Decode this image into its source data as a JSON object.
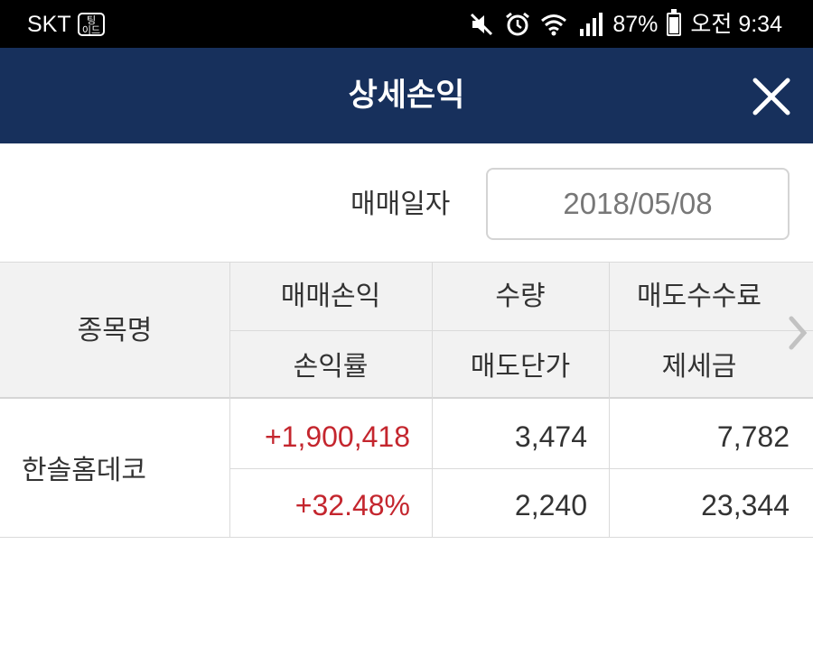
{
  "status_bar": {
    "carrier": "SKT",
    "carrier_badge": "팅\n이드",
    "battery": "87%",
    "time": "오전 9:34"
  },
  "header": {
    "title": "상세손익",
    "close_icon": "close-icon"
  },
  "date_filter": {
    "label": "매매일자",
    "value": "2018/05/08"
  },
  "table": {
    "headers": {
      "stock_name": "종목명",
      "trade_pl": "매매손익",
      "pl_rate": "손익률",
      "quantity": "수량",
      "sell_price": "매도단가",
      "sell_fee": "매도수수료",
      "taxes": "제세금"
    },
    "rows": [
      {
        "stock_name": "한솔홈데코",
        "trade_pl": "+1,900,418",
        "pl_rate": "+32.48%",
        "quantity": "3,474",
        "sell_price": "2,240",
        "sell_fee": "7,782",
        "taxes": "23,344"
      }
    ]
  },
  "colors": {
    "header_bg": "#17305c",
    "positive": "#c4262e",
    "table_header_bg": "#f2f2f2"
  }
}
